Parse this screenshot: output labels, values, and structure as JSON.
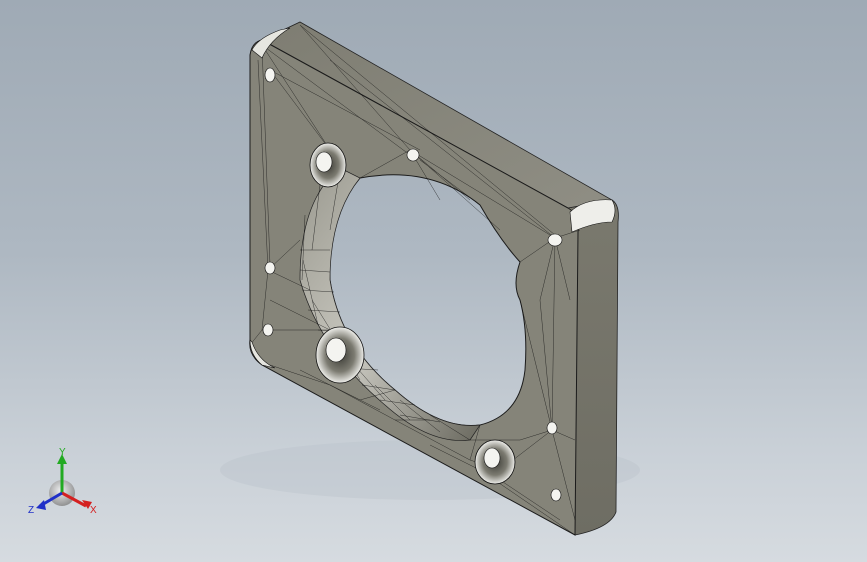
{
  "viewport": {
    "background_top": "#9faab5",
    "background_bottom": "#d6dbe0"
  },
  "model": {
    "face_color": "#86857a",
    "edge_color": "#1a1a1a",
    "highlight_color": "#f4f4f0"
  },
  "triad": {
    "x_label": "X",
    "y_label": "Y",
    "z_label": "Z",
    "x_color": "#d42020",
    "y_color": "#22aa22",
    "z_color": "#2030c8"
  }
}
